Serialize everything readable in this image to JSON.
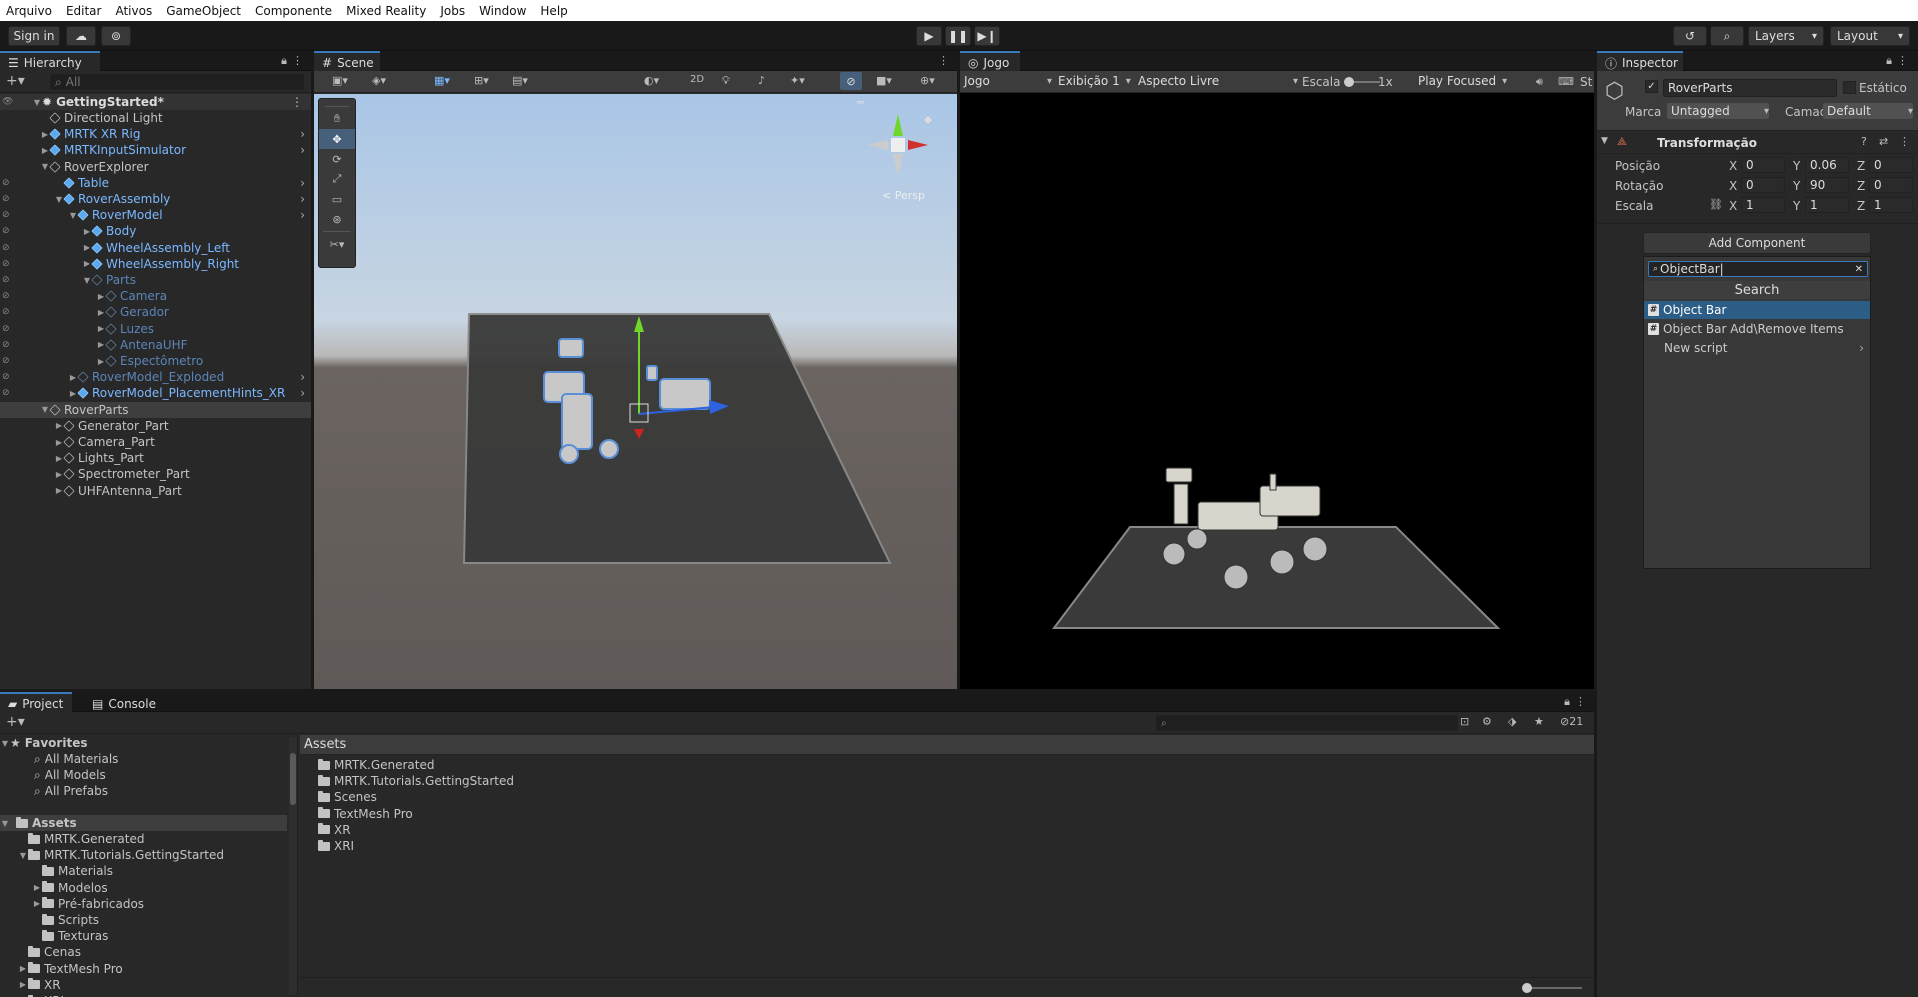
{
  "menu": [
    "Arquivo",
    "Editar",
    "Ativos",
    "GameObject",
    "Componente",
    "Mixed Reality",
    "Jobs",
    "Window",
    "Help"
  ],
  "toolbar": {
    "sign_in": "Sign in",
    "layers": "Layers",
    "layout": "Layout"
  },
  "hierarchy": {
    "title": "Hierarchy",
    "search_placeholder": "All",
    "scene": "GettingStarted*",
    "items": [
      {
        "label": "Directional Light",
        "depth": 1,
        "style": "normal"
      },
      {
        "label": "MRTK XR Rig",
        "depth": 1,
        "style": "blue"
      },
      {
        "label": "MRTKInputSimulator",
        "depth": 1,
        "style": "blue"
      },
      {
        "label": "RoverExplorer",
        "depth": 1,
        "style": "normal"
      },
      {
        "label": "Table",
        "depth": 2,
        "style": "blue"
      },
      {
        "label": "RoverAssembly",
        "depth": 2,
        "style": "blue"
      },
      {
        "label": "RoverModel",
        "depth": 3,
        "style": "blue"
      },
      {
        "label": "Body",
        "depth": 4,
        "style": "blue"
      },
      {
        "label": "WheelAssembly_Left",
        "depth": 4,
        "style": "blue"
      },
      {
        "label": "WheelAssembly_Right",
        "depth": 4,
        "style": "blue"
      },
      {
        "label": "Parts",
        "depth": 4,
        "style": "faded"
      },
      {
        "label": "Camera",
        "depth": 5,
        "style": "faded"
      },
      {
        "label": "Gerador",
        "depth": 5,
        "style": "faded"
      },
      {
        "label": "Luzes",
        "depth": 5,
        "style": "faded"
      },
      {
        "label": "AntenaUHF",
        "depth": 5,
        "style": "faded"
      },
      {
        "label": "Espectômetro",
        "depth": 5,
        "style": "faded"
      },
      {
        "label": "RoverModel_Exploded",
        "depth": 3,
        "style": "faded"
      },
      {
        "label": "RoverModel_PlacementHints_XR",
        "depth": 3,
        "style": "blue"
      },
      {
        "label": "RoverParts",
        "depth": 1,
        "style": "selected"
      },
      {
        "label": "Generator_Part",
        "depth": 2,
        "style": "normal"
      },
      {
        "label": "Camera_Part",
        "depth": 2,
        "style": "normal"
      },
      {
        "label": "Lights_Part",
        "depth": 2,
        "style": "normal"
      },
      {
        "label": "Spectrometer_Part",
        "depth": 2,
        "style": "normal"
      },
      {
        "label": "UHFAntenna_Part",
        "depth": 2,
        "style": "normal"
      }
    ]
  },
  "scene": {
    "title": "Scene",
    "mode_2d": "2D",
    "persp": "< Persp"
  },
  "game": {
    "title": "Jogo",
    "display_mode": "Jogo",
    "display": "Exibição 1",
    "aspect": "Aspecto Livre",
    "scale_label": "Escala",
    "scale_value": "1x",
    "play_mode": "Play Focused",
    "stats": "St"
  },
  "inspector": {
    "title": "Inspector",
    "object_name": "RoverParts",
    "static_label": "Estático",
    "tag_label": "Marca",
    "tag_value": "Untagged",
    "layer_label": "Camad",
    "layer_value": "Default",
    "transform_title": "Transformação",
    "position": {
      "label": "Posição",
      "x": "0",
      "y": "0.06",
      "z": "0"
    },
    "rotation": {
      "label": "Rotação",
      "x": "0",
      "y": "90",
      "z": "0"
    },
    "scale": {
      "label": "Escala",
      "x": "1",
      "y": "1",
      "z": "1"
    },
    "add_component": "Add Component",
    "search_value": "ObjectBar",
    "search_header": "Search",
    "results": [
      "Object Bar",
      "Object Bar Add\\Remove Items",
      "New script"
    ]
  },
  "project": {
    "tab_project": "Project",
    "tab_console": "Console",
    "favorites": "Favorites",
    "favorite_items": [
      "All Materials",
      "All Models",
      "All Prefabs"
    ],
    "assets_root": "Assets",
    "tree": [
      {
        "label": "MRTK.Generated",
        "depth": 1
      },
      {
        "label": "MRTK.Tutorials.GettingStarted",
        "depth": 1
      },
      {
        "label": "Materials",
        "depth": 2
      },
      {
        "label": "Modelos",
        "depth": 2
      },
      {
        "label": "Pré-fabricados",
        "depth": 2
      },
      {
        "label": "Scripts",
        "depth": 2
      },
      {
        "label": "Texturas",
        "depth": 2
      },
      {
        "label": "Cenas",
        "depth": 1
      },
      {
        "label": "TextMesh Pro",
        "depth": 1
      },
      {
        "label": "XR",
        "depth": 1
      },
      {
        "label": "XRI",
        "depth": 1
      }
    ],
    "breadcrumb": "Assets",
    "folders": [
      "MRTK.Generated",
      "MRTK.Tutorials.GettingStarted",
      "Scenes",
      "TextMesh Pro",
      "XR",
      "XRI"
    ],
    "hidden_count": "21"
  }
}
